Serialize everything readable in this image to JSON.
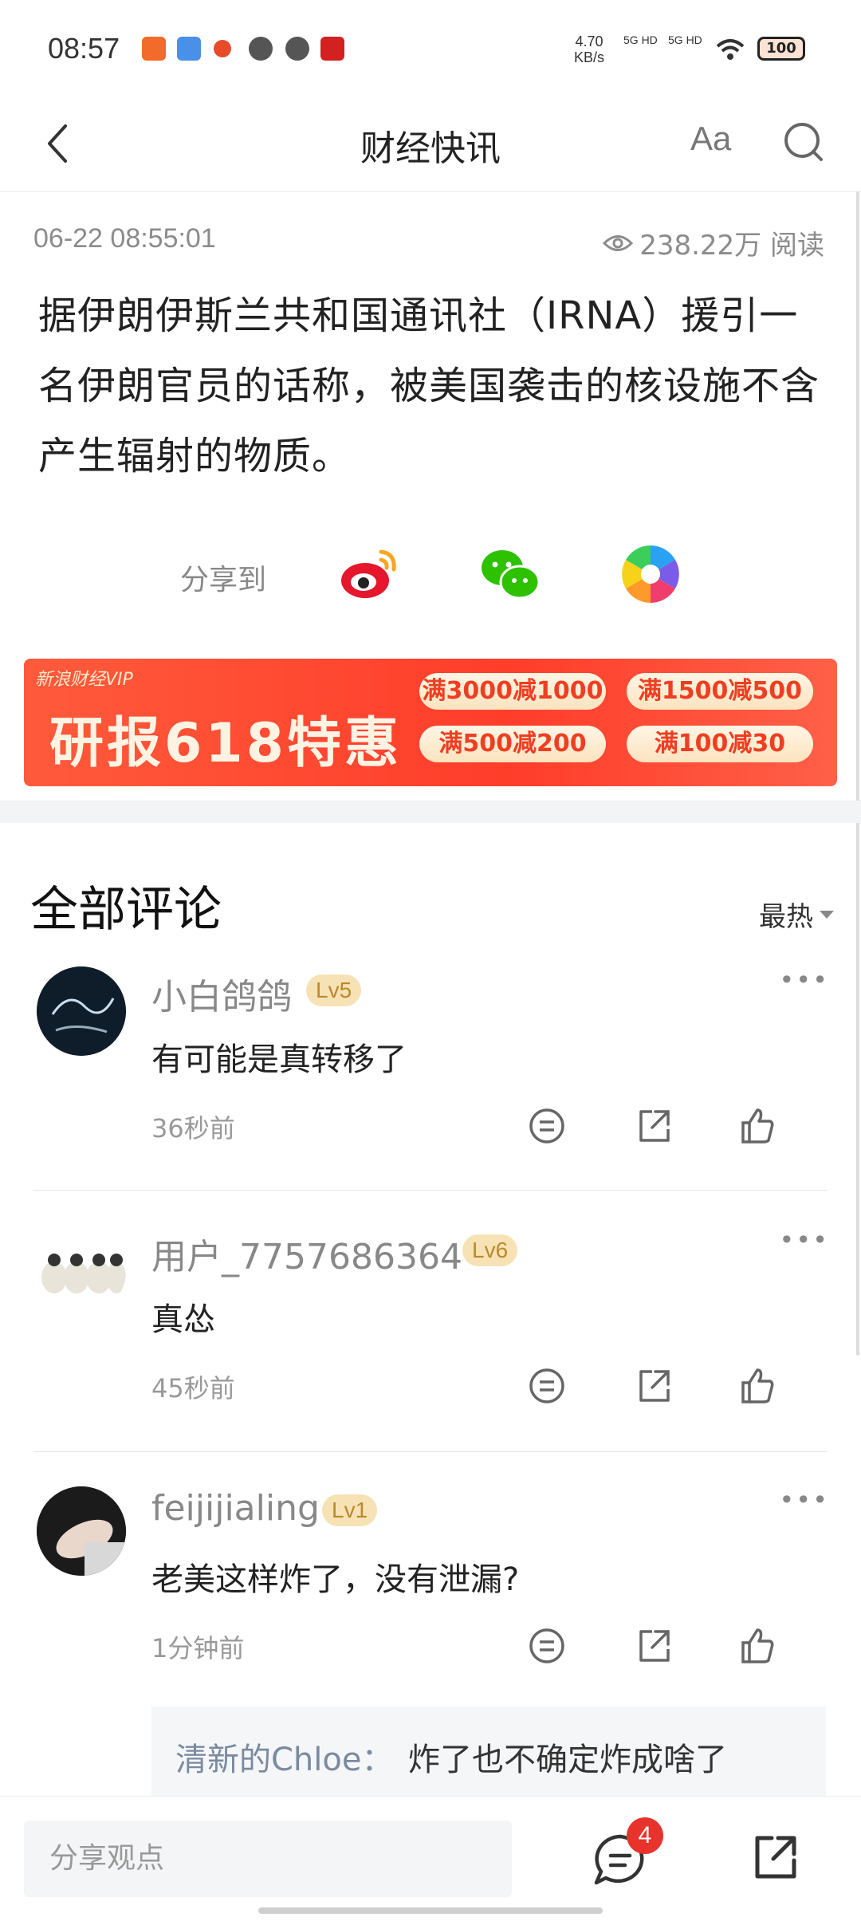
{
  "status": {
    "time": "08:57",
    "net_speed_value": "4.70",
    "net_speed_unit": "KB/s",
    "sig1": "5G HD",
    "sig2": "5G HD",
    "battery": "100"
  },
  "nav": {
    "title": "财经快讯",
    "font_label": "Aa"
  },
  "article": {
    "time": "06-22 08:55:01",
    "views": "238.22万 阅读",
    "body": "据伊朗伊斯兰共和国通讯社（IRNA）援引一名伊朗官员的话称，被美国袭击的核设施不含产生辐射的物质。"
  },
  "share": {
    "label": "分享到"
  },
  "banner": {
    "brand": "新浪财经VIP",
    "headline": "研报618特惠",
    "coupons": [
      "满3000减1000",
      "满1500减500",
      "满500减200",
      "满100减30"
    ]
  },
  "comments_section": {
    "title": "全部评论",
    "sort": "最热"
  },
  "comments": [
    {
      "name": "小白鸽鸽",
      "level": "Lv5",
      "text": "有可能是真转移了",
      "time": "36秒前"
    },
    {
      "name": "用户_7757686364",
      "level": "Lv6",
      "text": "真怂",
      "time": "45秒前"
    },
    {
      "name": "feijijialing",
      "level": "Lv1",
      "text": "老美这样炸了，没有泄漏?",
      "time": "1分钟前"
    }
  ],
  "reply": {
    "name": "清新的Chloe：",
    "text": "炸了也不确定炸成啥了"
  },
  "bottom": {
    "placeholder": "分享观点",
    "badge": "4"
  },
  "colors": {
    "accent_red": "#e8322c",
    "level_bg": "#f7e2b5",
    "banner_red": "#ff3d2a"
  }
}
